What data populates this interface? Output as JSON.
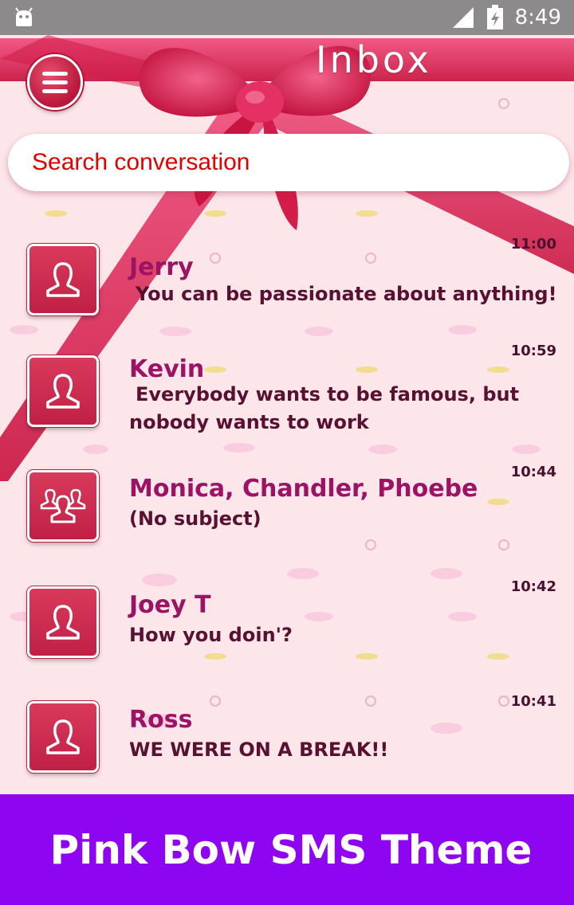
{
  "status_bar": {
    "time": "8:49",
    "icons": [
      "android-icon",
      "signal-icon",
      "battery-icon"
    ]
  },
  "header": {
    "title": "Inbox",
    "menu_icon": "hamburger-menu-icon"
  },
  "search": {
    "placeholder": "Search conversation"
  },
  "conversations": [
    {
      "name": "Jerry",
      "snippet": "You can be passionate about anything!",
      "time": "11:00",
      "avatar": "person-icon"
    },
    {
      "name": "Kevin",
      "snippet": "Everybody wants to be famous, but nobody wants to work",
      "time": "10:59",
      "avatar": "person-icon"
    },
    {
      "name": "Monica, Chandler, Phoebe",
      "snippet": "(No subject)",
      "time": "10:44",
      "avatar": "group-icon"
    },
    {
      "name": "Joey T",
      "snippet": "How you doin'?",
      "time": "10:42",
      "avatar": "person-icon"
    },
    {
      "name": "Ross",
      "snippet": "WE WERE ON A BREAK!!",
      "time": "10:41",
      "avatar": "person-icon"
    }
  ],
  "promo": {
    "text": "Pink Bow SMS Theme"
  },
  "colors": {
    "background": "#fde6ea",
    "ribbon": "#e0245a",
    "avatar": "#c8284c",
    "name": "#9c1364",
    "promo_banner": "#8e06f1",
    "search_placeholder": "#e00000"
  }
}
